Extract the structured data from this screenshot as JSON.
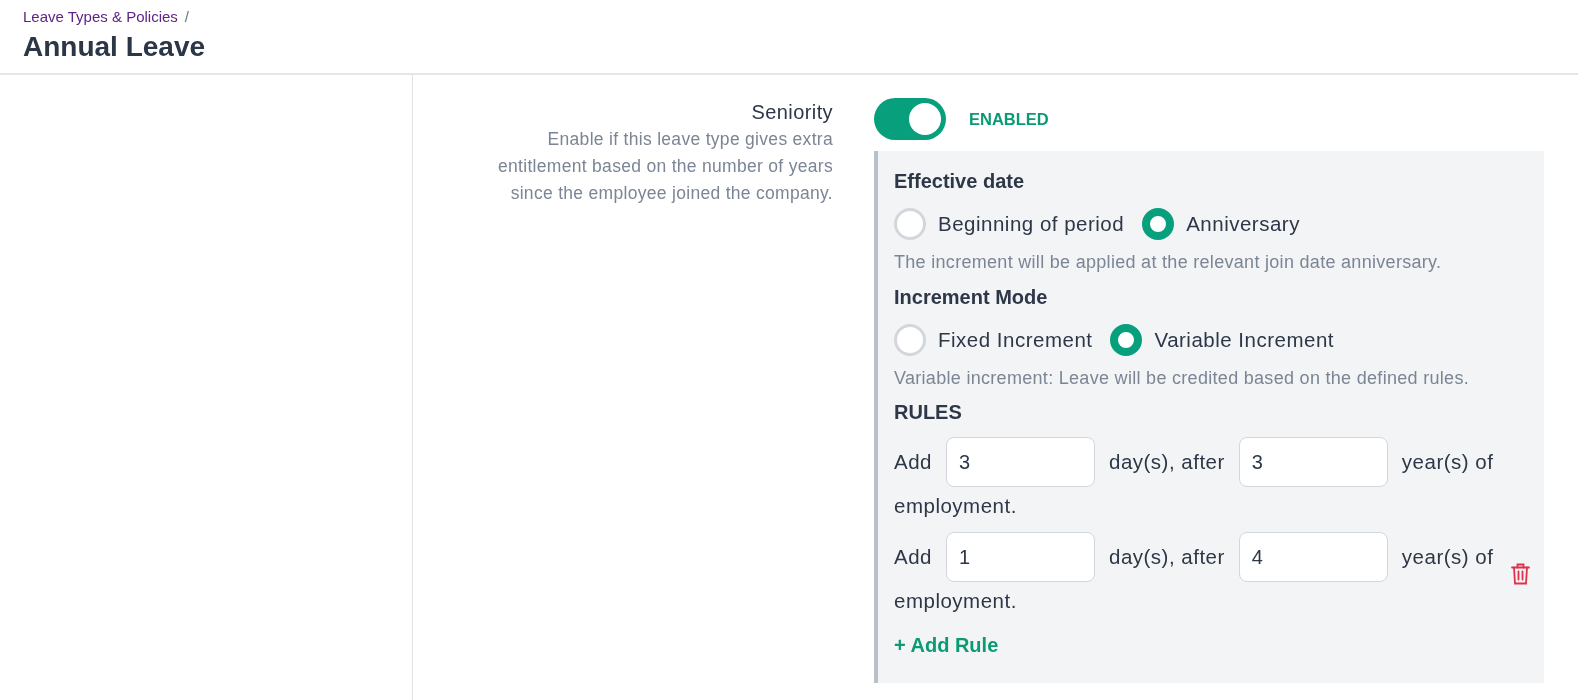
{
  "breadcrumb": {
    "items": [
      {
        "label": "Leave Types & Policies"
      }
    ],
    "separator": "/"
  },
  "page_title": "Annual Leave",
  "seniority": {
    "label": "Seniority",
    "description": "Enable if this leave type gives extra entitlement based on the number of years since the employee joined the company.",
    "enabled": true,
    "status_label": "ENABLED"
  },
  "effective_date": {
    "heading": "Effective date",
    "options": [
      {
        "label": "Beginning of period",
        "selected": false
      },
      {
        "label": "Anniversary",
        "selected": true
      }
    ],
    "help": "The increment will be applied at the relevant join date anniversary."
  },
  "increment_mode": {
    "heading": "Increment Mode",
    "options": [
      {
        "label": "Fixed Increment",
        "selected": false
      },
      {
        "label": "Variable Increment",
        "selected": true
      }
    ],
    "help": "Variable increment: Leave will be credited based on the defined rules."
  },
  "rules": {
    "heading": "RULES",
    "items": [
      {
        "prefix": "Add",
        "days": "3",
        "middle": "day(s), after",
        "years": "3",
        "suffix": "year(s) of",
        "continuation": "employment.",
        "removable": false
      },
      {
        "prefix": "Add",
        "days": "1",
        "middle": "day(s), after",
        "years": "4",
        "suffix": "year(s) of",
        "continuation": "employment.",
        "removable": true
      }
    ],
    "add_button": "+ Add Rule"
  }
}
